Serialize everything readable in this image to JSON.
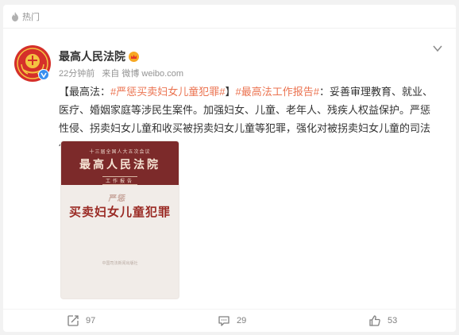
{
  "hot_bar": {
    "icon": "flame-icon",
    "label": "热门"
  },
  "post": {
    "author": "最高人民法院",
    "author_badge": "crown-icon",
    "time": "22分钟前",
    "source": "来自 微博 weibo.com",
    "text": {
      "prefix": "【最高法：",
      "tag1": "#严惩买卖妇女儿童犯罪#",
      "mid": "】",
      "tag2": "#最高法工作报告#",
      "body": "：妥善审理教育、就业、医疗、婚姻家庭等涉民生案件。加强妇女、儿童、老年人、残疾人权益保护。严惩性侵、拐卖妇女儿童和收买被拐卖妇女儿童等犯罪，强化对被拐卖妇女儿童的司法保障。"
    },
    "image": {
      "subtitle": "十三届全国人大五次会议",
      "court_name": "最高人民法院",
      "report_label": "工作报告",
      "brush_text": "严惩",
      "main_title": "买卖妇女儿童犯罪",
      "footer": "中国司法新闻出版社"
    },
    "actions": {
      "repost_count": "97",
      "comment_count": "29",
      "like_count": "53"
    }
  },
  "colors": {
    "tag": "#eb7350",
    "cover_red": "#7c2a2a",
    "title_red": "#9a2a24",
    "verified_blue": "#3a8ff0"
  }
}
